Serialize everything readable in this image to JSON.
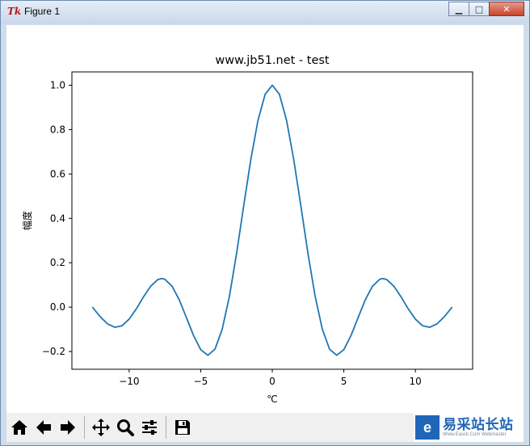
{
  "window": {
    "title": "Figure 1",
    "app_icon": "tk-feather-icon",
    "controls": {
      "minimize": "minimize-icon",
      "maximize": "maximize-icon",
      "close": "close-icon"
    }
  },
  "chart_data": {
    "type": "line",
    "title": "www.jb51.net - test",
    "xlabel": "℃",
    "ylabel": "幅度",
    "xlim": [
      -14,
      14
    ],
    "ylim": [
      -0.28,
      1.06
    ],
    "xticks": [
      -10,
      -5,
      0,
      5,
      10
    ],
    "xtick_labels": [
      "−10",
      "−5",
      "0",
      "5",
      "10"
    ],
    "yticks": [
      -0.2,
      0.0,
      0.2,
      0.4,
      0.6,
      0.8,
      1.0
    ],
    "ytick_labels": [
      "−0.2",
      "0.0",
      "0.2",
      "0.4",
      "0.6",
      "0.8",
      "1.0"
    ],
    "grid": false,
    "line_color": "#1f77b4",
    "series": [
      {
        "x": [
          -12.57,
          -12.0,
          -11.5,
          -11.0,
          -10.5,
          -10.0,
          -9.5,
          -9.0,
          -8.5,
          -8.0,
          -7.7,
          -7.5,
          -7.0,
          -6.5,
          -6.0,
          -5.5,
          -5.0,
          -4.5,
          -4.0,
          -3.5,
          -3.0,
          -2.5,
          -2.0,
          -1.5,
          -1.0,
          -0.5,
          0.0,
          0.5,
          1.0,
          1.5,
          2.0,
          2.5,
          3.0,
          3.5,
          4.0,
          4.5,
          5.0,
          5.5,
          6.0,
          6.5,
          7.0,
          7.5,
          7.7,
          8.0,
          8.5,
          9.0,
          9.5,
          10.0,
          10.5,
          11.0,
          11.5,
          12.0,
          12.57
        ],
        "y": [
          0.0,
          -0.045,
          -0.076,
          -0.091,
          -0.084,
          -0.054,
          -0.008,
          0.046,
          0.094,
          0.124,
          0.129,
          0.125,
          0.094,
          0.033,
          -0.047,
          -0.128,
          -0.192,
          -0.217,
          -0.189,
          -0.1,
          0.047,
          0.239,
          0.455,
          0.665,
          0.841,
          0.959,
          1.0,
          0.959,
          0.841,
          0.665,
          0.455,
          0.239,
          0.047,
          -0.1,
          -0.189,
          -0.217,
          -0.192,
          -0.128,
          -0.047,
          0.033,
          0.094,
          0.125,
          0.129,
          0.124,
          0.094,
          0.046,
          -0.008,
          -0.054,
          -0.084,
          -0.091,
          -0.076,
          -0.045,
          0.0
        ]
      }
    ]
  },
  "toolbar": {
    "buttons": [
      {
        "name": "home-button",
        "icon": "home-icon"
      },
      {
        "name": "back-button",
        "icon": "arrow-left-icon"
      },
      {
        "name": "forward-button",
        "icon": "arrow-right-icon"
      },
      {
        "name": "pan-button",
        "icon": "move-icon"
      },
      {
        "name": "zoom-button",
        "icon": "magnifier-icon"
      },
      {
        "name": "configure-subplots-button",
        "icon": "sliders-icon"
      },
      {
        "name": "save-button",
        "icon": "floppy-disk-icon"
      }
    ]
  },
  "watermark": {
    "logo_glyph": "e",
    "main": "易采站长站",
    "sub": "Www.Easck.Com  Webmaster"
  }
}
